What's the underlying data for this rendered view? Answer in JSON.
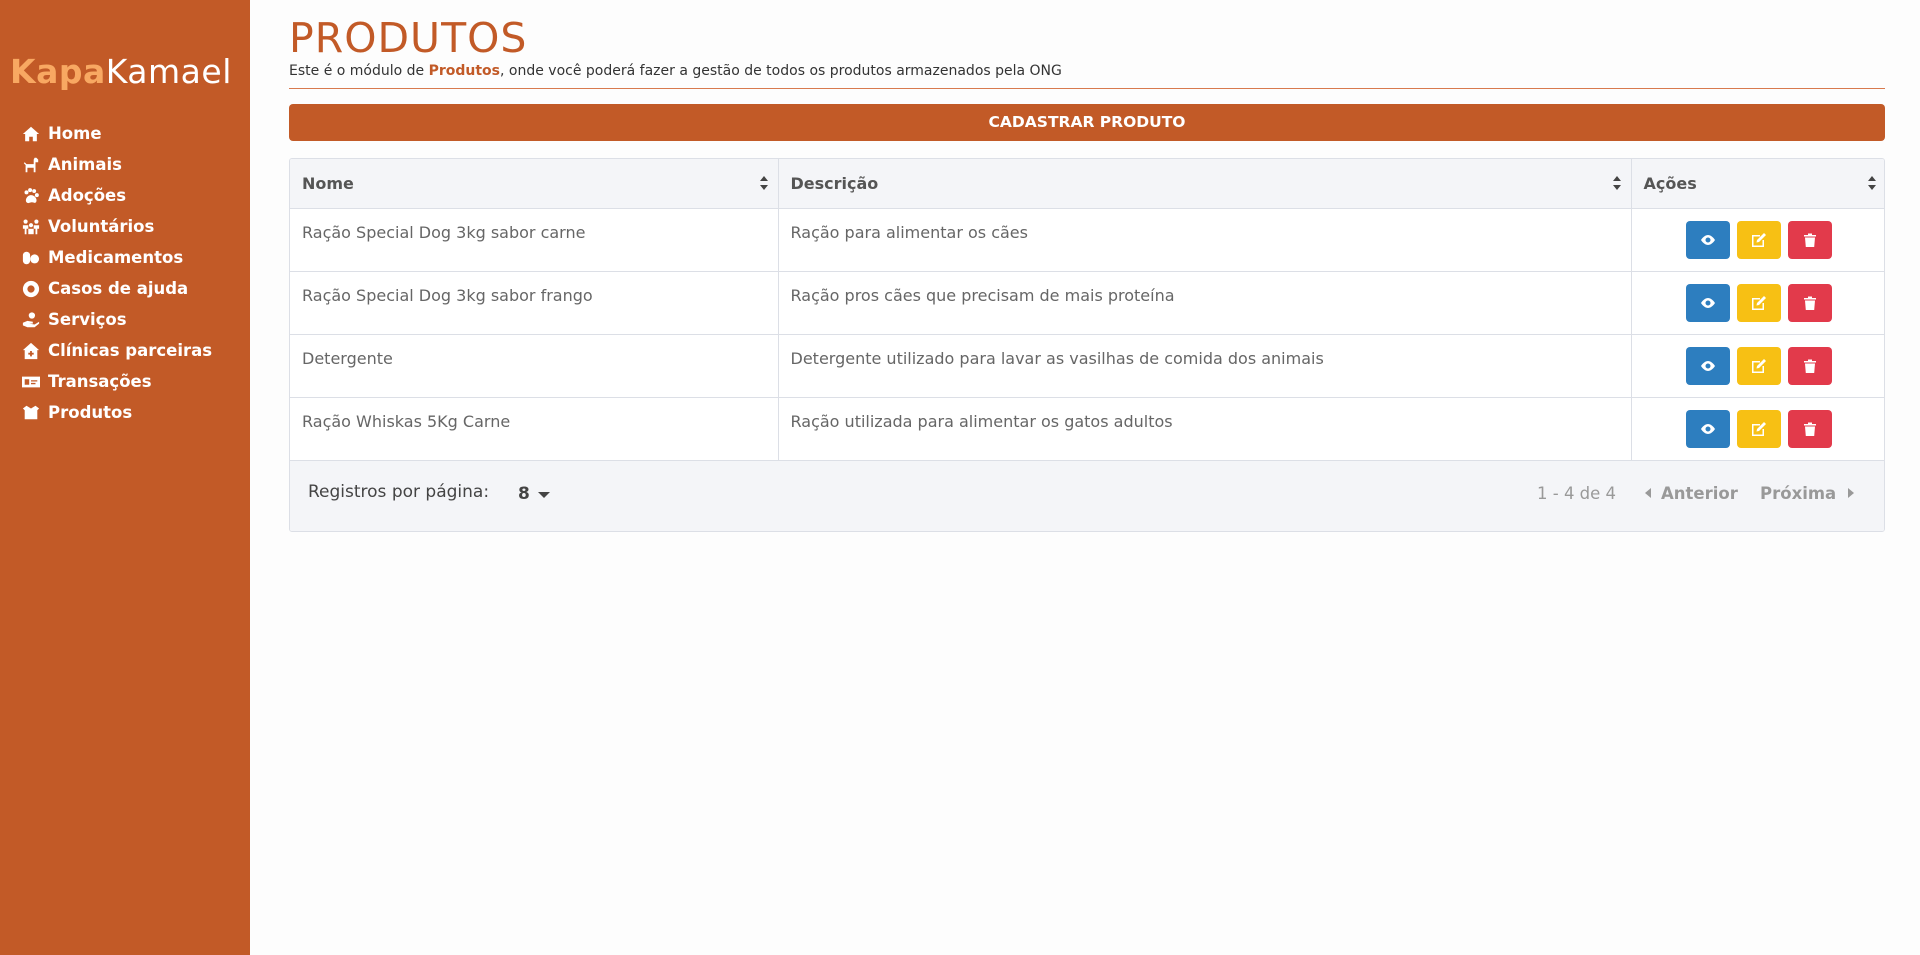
{
  "colors": {
    "brand": "#c25a27",
    "brand_light": "#f8a862",
    "view": "#2d7ebf",
    "edit": "#f7c014",
    "delete": "#e23a4b"
  },
  "sidebar": {
    "brand_part1": "Kapa",
    "brand_part2": "Kamael",
    "items": [
      {
        "label": "Home",
        "icon": "home-icon"
      },
      {
        "label": "Animais",
        "icon": "dog-icon"
      },
      {
        "label": "Adoções",
        "icon": "paw-icon"
      },
      {
        "label": "Voluntários",
        "icon": "people-icon"
      },
      {
        "label": "Medicamentos",
        "icon": "pills-icon"
      },
      {
        "label": "Casos de ajuda",
        "icon": "lifebuoy-icon"
      },
      {
        "label": "Serviços",
        "icon": "hand-holding-icon"
      },
      {
        "label": "Clínicas parceiras",
        "icon": "clinic-icon"
      },
      {
        "label": "Transações",
        "icon": "money-icon"
      },
      {
        "label": "Produtos",
        "icon": "box-icon"
      }
    ]
  },
  "page": {
    "title": "PRODUTOS",
    "subtitle_before": "Este é o módulo de ",
    "subtitle_bold": "Produtos",
    "subtitle_after": ", onde você poderá fazer a gestão de todos os produtos armazenados pela ONG",
    "cta_label": "CADASTRAR PRODUTO"
  },
  "table": {
    "columns": [
      "Nome",
      "Descrição",
      "Ações"
    ],
    "rows": [
      {
        "nome": "Ração Special Dog 3kg sabor carne",
        "descricao": "Ração para alimentar os cães"
      },
      {
        "nome": "Ração Special Dog 3kg sabor frango",
        "descricao": "Ração pros cães que precisam de mais proteína"
      },
      {
        "nome": "Detergente",
        "descricao": "Detergente utilizado para lavar as vasilhas de comida dos animais"
      },
      {
        "nome": "Ração Whiskas 5Kg Carne",
        "descricao": "Ração utilizada para alimentar os gatos adultos"
      }
    ]
  },
  "pagination": {
    "per_page_label": "Registros por página:",
    "per_page_value": "8",
    "range": "1 - 4 de 4",
    "prev_label": "Anterior",
    "next_label": "Próxima"
  }
}
